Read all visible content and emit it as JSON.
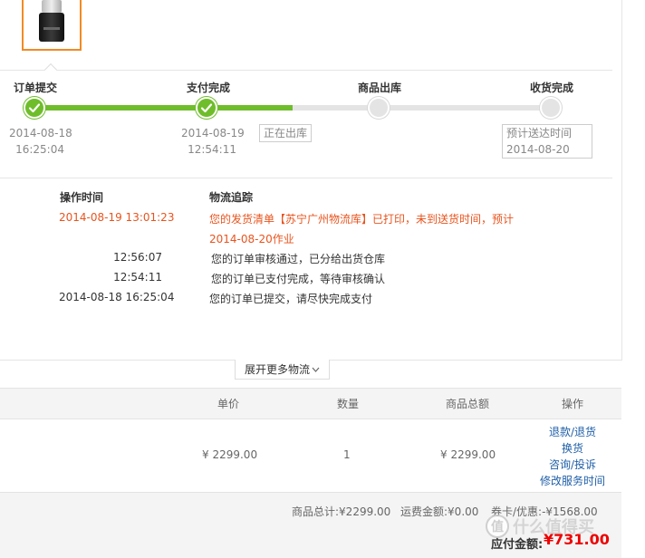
{
  "product": {
    "icon": "juicer-product-thumbnail"
  },
  "steps": [
    {
      "label": "订单提交",
      "date": "2014-08-18",
      "time": "16:25:04",
      "state": "done"
    },
    {
      "label": "支付完成",
      "date": "2014-08-19",
      "time": "12:54:11",
      "state": "done"
    },
    {
      "label": "商品出库",
      "state": "todo"
    },
    {
      "label": "收货完成",
      "state": "todo"
    }
  ],
  "progress": {
    "current_status": "正在出库",
    "eta_label": "预计送达时间",
    "eta_date": "2014-08-20"
  },
  "logistics": {
    "time_header": "操作时间",
    "track_header": "物流追踪",
    "entries": [
      {
        "time": "2014-08-19 13:01:23",
        "text": "您的发货清单【苏宁广州物流库】已打印，未到送货时间，预计",
        "text_cont": "2014-08-20作业",
        "highlight": true
      },
      {
        "time": "12:56:07",
        "text": "您的订单审核通过，已分给出货仓库"
      },
      {
        "time": "12:54:11",
        "text": "您的订单已支付完成，等待审核确认"
      },
      {
        "time": "2014-08-18 16:25:04",
        "text": "您的订单已提交，请尽快完成支付"
      }
    ],
    "more_label": "展开更多物流",
    "more_icon": "chevron-down-icon"
  },
  "table": {
    "headers": [
      "单价",
      "数量",
      "商品总额",
      "操作"
    ],
    "row": {
      "unit_price": "¥ 2299.00",
      "quantity": "1",
      "total": "¥ 2299.00"
    },
    "actions": [
      "退款/退货",
      "换货",
      "咨询/投诉",
      "修改服务时间"
    ]
  },
  "summary": {
    "goods_total": "商品总计:¥2299.00",
    "shipping": "运费金额:¥0.00",
    "coupon": "券卡/优惠:-¥1568.00",
    "pay_label": "应付金额:",
    "pay_amount": "¥731.00"
  },
  "watermark": {
    "logo": "值",
    "text": "什么值得买"
  },
  "colors": {
    "progress_green": "#6fbd2b",
    "highlight_orange": "#e8541e",
    "link_blue": "#1f5fa8",
    "price_red": "#e00000",
    "thumb_border": "#f08a24"
  }
}
